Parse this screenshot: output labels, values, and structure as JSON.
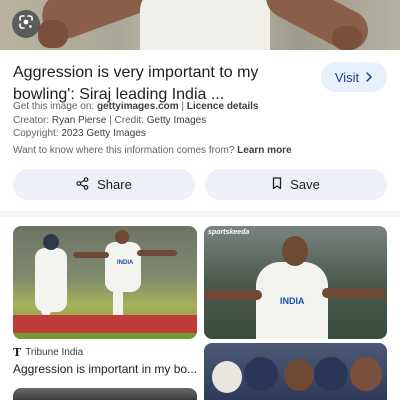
{
  "title": "Aggression is very important to my bowling': Siraj leading India ...",
  "visit_label": "Visit",
  "meta": {
    "get_image_prefix": "Get this image on: ",
    "get_image_site": "gettyimages.com",
    "separator": " | ",
    "licence_label": "Licence details",
    "creator_label": "Creator: ",
    "creator_value": "Ryan Pierse",
    "credit_label": "Credit: ",
    "credit_value": "Getty Images",
    "copyright_label": "Copyright: ",
    "copyright_value": "2023 Getty Images",
    "question": "Want to know where this information comes from? ",
    "learn_more": "Learn more"
  },
  "actions": {
    "share_label": "Share",
    "save_label": "Save"
  },
  "results": [
    {
      "source_logo": "T",
      "source": "Tribune India",
      "title": "Aggression is important in my bo...",
      "jersey_text": "INDIA"
    },
    {
      "brand": "sportskeeda",
      "jersey_text": "INDIA"
    }
  ],
  "colors": {
    "accent": "#1a3f8f",
    "visit_bg": "#e8f0fe",
    "button_bg": "#edf1f7"
  },
  "icons": {
    "lens": "google-lens-icon",
    "visit": "chevron-right-icon",
    "share": "share-icon",
    "save": "bookmark-icon"
  }
}
